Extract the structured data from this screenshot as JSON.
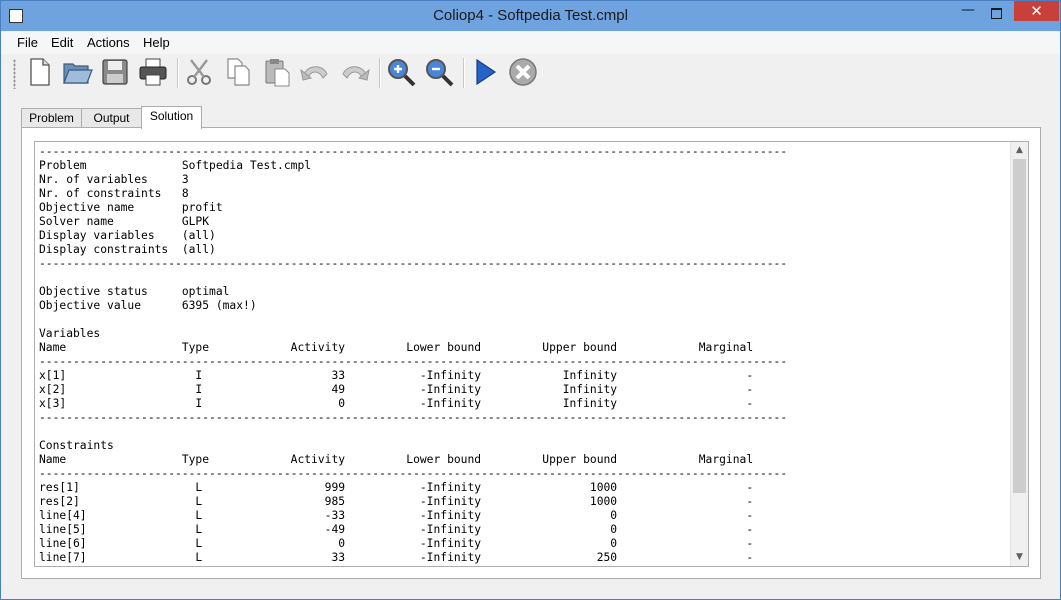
{
  "window": {
    "title": "Coliop4 - Softpedia Test.cmpl",
    "minimize_glyph": "—",
    "close_glyph": "✕"
  },
  "menu": {
    "file": "File",
    "edit": "Edit",
    "actions": "Actions",
    "help": "Help"
  },
  "toolbar": {
    "icons": [
      "new-file-icon",
      "open-folder-icon",
      "save-icon",
      "print-icon",
      "cut-icon",
      "copy-icon",
      "paste-icon",
      "undo-icon",
      "redo-icon",
      "zoom-in-icon",
      "zoom-out-icon",
      "run-icon",
      "stop-icon"
    ]
  },
  "tabs": {
    "problem": "Problem",
    "output": "Output",
    "solution": "Solution",
    "active": "solution"
  },
  "colors": {
    "titlebar": "#6fa3e0",
    "close_button": "#c7403a",
    "run_blue": "#2563c9"
  },
  "solution": {
    "text": "--------------------------------------------------------------------------------------------------------------\nProblem              Softpedia Test.cmpl\nNr. of variables     3\nNr. of constraints   8\nObjective name       profit\nSolver name          GLPK\nDisplay variables    (all)\nDisplay constraints  (all)\n--------------------------------------------------------------------------------------------------------------\n\nObjective status     optimal\nObjective value      6395 (max!)\n\nVariables\nName                 Type            Activity         Lower bound         Upper bound            Marginal\n--------------------------------------------------------------------------------------------------------------\nx[1]                   I                   33           -Infinity            Infinity                   -\nx[2]                   I                   49           -Infinity            Infinity                   -\nx[3]                   I                    0           -Infinity            Infinity                   -\n--------------------------------------------------------------------------------------------------------------\n\nConstraints\nName                 Type            Activity         Lower bound         Upper bound            Marginal\n--------------------------------------------------------------------------------------------------------------\nres[1]                 L                  999           -Infinity                1000                   -\nres[2]                 L                  985           -Infinity                1000                   -\nline[4]                L                  -33           -Infinity                   0                   -\nline[5]                L                  -49           -Infinity                   0                   -\nline[6]                L                    0           -Infinity                   0                   -\nline[7]                L                   33           -Infinity                 250                   -"
  },
  "scrollbar": {
    "up_glyph": "▲",
    "down_glyph": "▼"
  }
}
